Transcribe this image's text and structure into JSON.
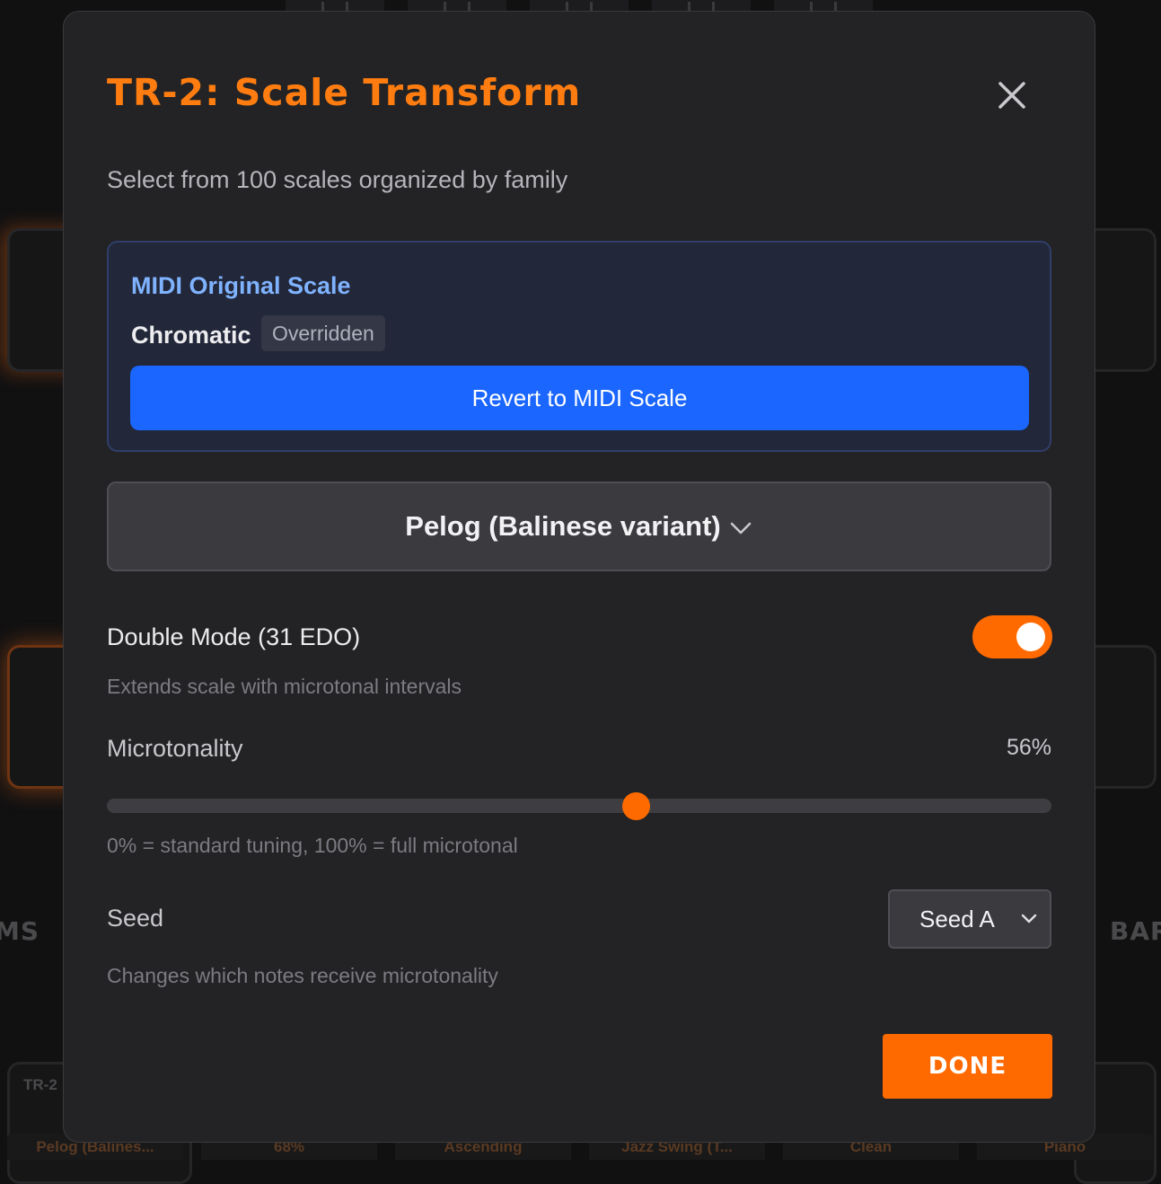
{
  "modal": {
    "title": "TR-2: Scale Transform",
    "subtitle": "Select from 100 scales organized by family",
    "close_icon": "close-icon",
    "midi_original": {
      "heading": "MIDI Original Scale",
      "scale_name": "Chromatic",
      "badge": "Overridden",
      "revert_label": "Revert to MIDI Scale"
    },
    "scale_select": {
      "value": "Pelog (Balinese variant)",
      "icon": "chevron-down-icon"
    },
    "double_mode": {
      "label": "Double Mode (31 EDO)",
      "enabled": true,
      "hint": "Extends scale with microtonal intervals"
    },
    "microtonality": {
      "label": "Microtonality",
      "value_text": "56%",
      "value": 0.56,
      "hint": "0% = standard tuning, 100% = full microtonal"
    },
    "seed": {
      "label": "Seed",
      "value": "Seed A",
      "hint": "Changes which notes receive microtonality"
    },
    "done_label": "DONE"
  },
  "background": {
    "left_heading_fragment": "MS",
    "right_heading_fragment": "BAR",
    "slot_label_fragment": "TR-2",
    "slots": [
      "Pelog (Balines...",
      "68%",
      "Ascending",
      "Jazz Swing (T...",
      "Clean",
      "Piano"
    ]
  },
  "colors": {
    "accent": "#ff6a00",
    "title": "#ff7d10",
    "primary_button": "#1a66ff",
    "midi_heading": "#7fb3ff",
    "modal_bg": "#232325"
  }
}
